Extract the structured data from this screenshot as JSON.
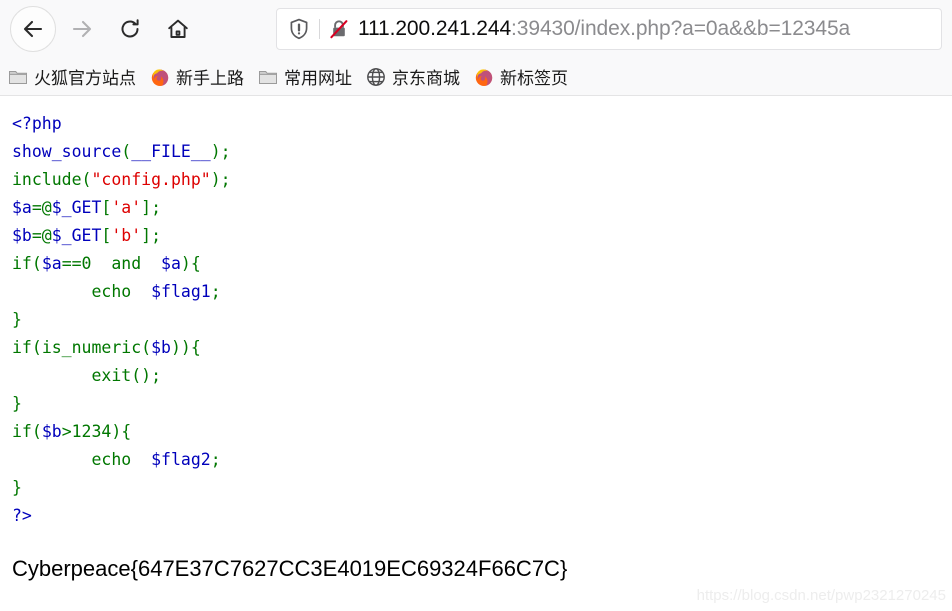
{
  "browser": {
    "nav": {
      "back_label": "Back",
      "forward_label": "Forward",
      "reload_label": "Reload",
      "home_label": "Home"
    },
    "urlbar": {
      "shield_icon": "shield-icon",
      "security_icon": "lock-crossed-icon",
      "host": "111.200.241.244",
      "rest": ":39430/index.php?a=0a&&b=12345a",
      "full_url": "111.200.241.244:39430/index.php?a=0a&&b=12345a"
    },
    "bookmarks": [
      {
        "label": "火狐官方站点",
        "icon": "folder-icon"
      },
      {
        "label": "新手上路",
        "icon": "firefox-icon"
      },
      {
        "label": "常用网址",
        "icon": "folder-icon"
      },
      {
        "label": "京东商城",
        "icon": "globe-icon"
      },
      {
        "label": "新标签页",
        "icon": "firefox-icon"
      }
    ]
  },
  "page": {
    "code_lines": [
      [
        {
          "t": "<?php",
          "c": "tg"
        }
      ],
      [
        {
          "t": "show_source",
          "c": "v"
        },
        {
          "t": "(",
          "c": "k"
        },
        {
          "t": "__FILE__",
          "c": "v"
        },
        {
          "t": ")",
          "c": "k"
        },
        {
          "t": ";",
          "c": "k"
        }
      ],
      [
        {
          "t": "include",
          "c": "k"
        },
        {
          "t": "(",
          "c": "k"
        },
        {
          "t": "\"config.php\"",
          "c": "s"
        },
        {
          "t": ")",
          "c": "k"
        },
        {
          "t": ";",
          "c": "k"
        }
      ],
      [
        {
          "t": "$a",
          "c": "v"
        },
        {
          "t": "=@",
          "c": "k"
        },
        {
          "t": "$_GET",
          "c": "v"
        },
        {
          "t": "[",
          "c": "k"
        },
        {
          "t": "'a'",
          "c": "s"
        },
        {
          "t": "]",
          "c": "k"
        },
        {
          "t": ";",
          "c": "k"
        }
      ],
      [
        {
          "t": "$b",
          "c": "v"
        },
        {
          "t": "=@",
          "c": "k"
        },
        {
          "t": "$_GET",
          "c": "v"
        },
        {
          "t": "[",
          "c": "k"
        },
        {
          "t": "'b'",
          "c": "s"
        },
        {
          "t": "]",
          "c": "k"
        },
        {
          "t": ";",
          "c": "k"
        }
      ],
      [
        {
          "t": "if",
          "c": "k"
        },
        {
          "t": "(",
          "c": "k"
        },
        {
          "t": "$a",
          "c": "v"
        },
        {
          "t": "==0  and  ",
          "c": "k"
        },
        {
          "t": "$a",
          "c": "v"
        },
        {
          "t": ")",
          "c": "k"
        },
        {
          "t": "{",
          "c": "k"
        }
      ],
      [
        {
          "t": "        echo  ",
          "c": "k"
        },
        {
          "t": "$flag1",
          "c": "v"
        },
        {
          "t": ";",
          "c": "k"
        }
      ],
      [
        {
          "t": "}",
          "c": "k"
        }
      ],
      [
        {
          "t": "if",
          "c": "k"
        },
        {
          "t": "(",
          "c": "k"
        },
        {
          "t": "is_numeric",
          "c": "k"
        },
        {
          "t": "(",
          "c": "k"
        },
        {
          "t": "$b",
          "c": "v"
        },
        {
          "t": "))",
          "c": "k"
        },
        {
          "t": "{",
          "c": "k"
        }
      ],
      [
        {
          "t": "        exit",
          "c": "k"
        },
        {
          "t": "()",
          "c": "k"
        },
        {
          "t": ";",
          "c": "k"
        }
      ],
      [
        {
          "t": "}",
          "c": "k"
        }
      ],
      [
        {
          "t": "if",
          "c": "k"
        },
        {
          "t": "(",
          "c": "k"
        },
        {
          "t": "$b",
          "c": "v"
        },
        {
          "t": ">1234",
          "c": "k"
        },
        {
          "t": ")",
          "c": "k"
        },
        {
          "t": "{",
          "c": "k"
        }
      ],
      [
        {
          "t": "        echo  ",
          "c": "k"
        },
        {
          "t": "$flag2",
          "c": "v"
        },
        {
          "t": ";",
          "c": "k"
        }
      ],
      [
        {
          "t": "}",
          "c": "k"
        }
      ],
      [
        {
          "t": "?>",
          "c": "tg"
        }
      ]
    ],
    "flag": "Cyberpeace{647E37C7627CC3E4019EC69324F66C7C}",
    "watermark": "https://blog.csdn.net/pwp2321270245"
  },
  "colors": {
    "keyword_green": "#007700",
    "variable_blue": "#0000bb",
    "string_red": "#dd0000",
    "chrome_bg": "#f9f9fa",
    "page_bg": "#ffffff"
  }
}
